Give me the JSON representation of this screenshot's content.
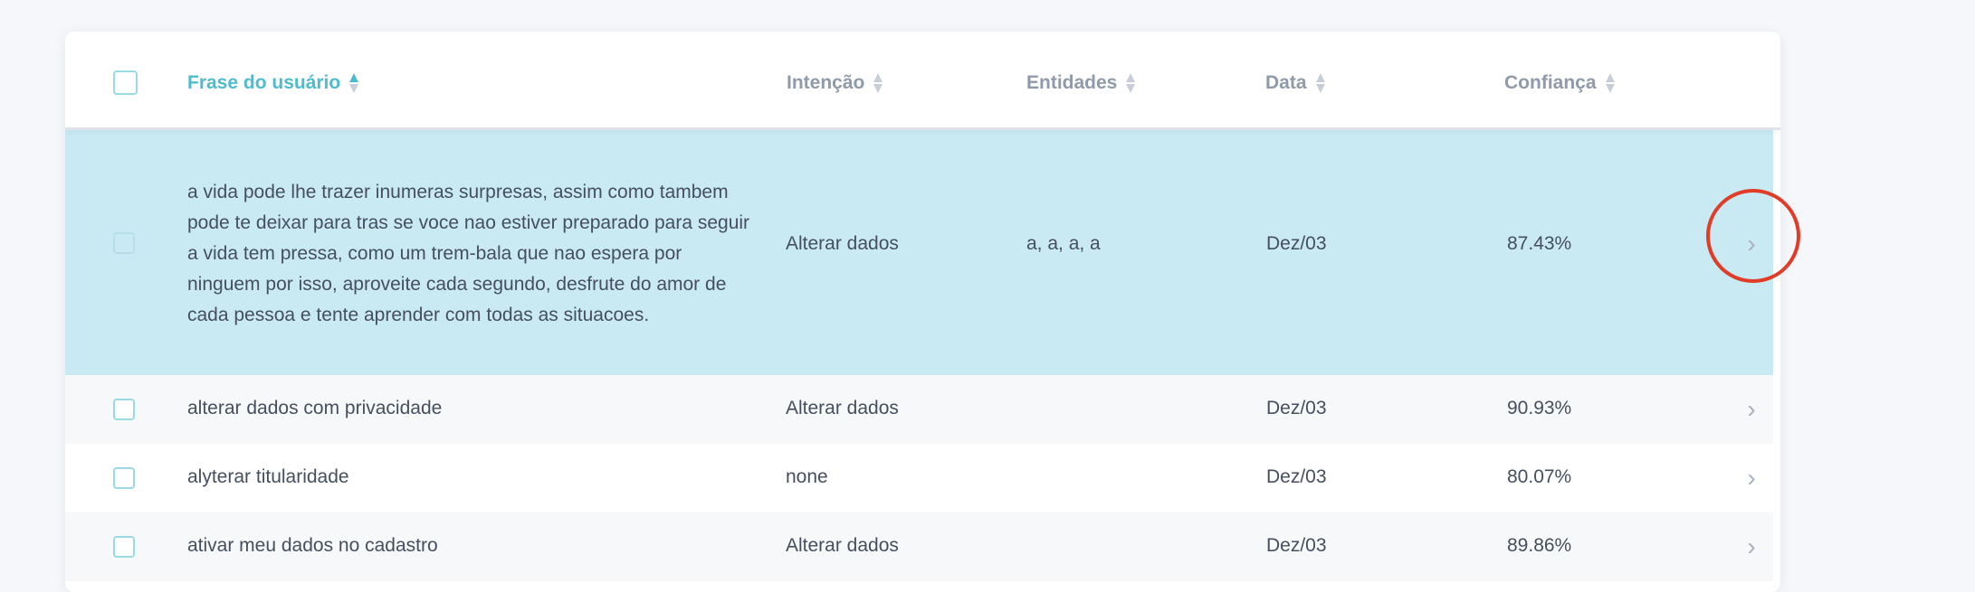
{
  "table": {
    "columns": [
      {
        "label": "Frase do usuário",
        "active": true
      },
      {
        "label": "Intenção",
        "active": false
      },
      {
        "label": "Entidades",
        "active": false
      },
      {
        "label": "Data",
        "active": false
      },
      {
        "label": "Confiança",
        "active": false
      }
    ],
    "rows": [
      {
        "phrase": "a vida pode lhe trazer inumeras surpresas, assim como tambem pode te deixar para tras se voce nao estiver preparado para seguir a vida tem pressa, como um trem-bala que nao espera por ninguem por isso, aproveite cada segundo, desfrute do amor de cada pessoa e tente aprender com todas as situacoes.",
        "intent": "Alterar dados",
        "entities": "a, a, a, a",
        "date": "Dez/03",
        "confidence": "87.43%",
        "selected": true
      },
      {
        "phrase": "alterar dados com privacidade",
        "intent": "Alterar dados",
        "entities": "",
        "date": "Dez/03",
        "confidence": "90.93%",
        "selected": false
      },
      {
        "phrase": "alyterar titularidade",
        "intent": "none",
        "entities": "",
        "date": "Dez/03",
        "confidence": "80.07%",
        "selected": false
      },
      {
        "phrase": "ativar meu dados no cadastro",
        "intent": "Alterar dados",
        "entities": "",
        "date": "Dez/03",
        "confidence": "89.86%",
        "selected": false
      }
    ]
  },
  "icons": {
    "row_open": "chevron-right-icon",
    "sort": "sort-arrows-icon"
  },
  "colors": {
    "accent": "#4dbcce",
    "selected_row": "#c9eaf2",
    "highlight_ring": "#e03c28"
  }
}
